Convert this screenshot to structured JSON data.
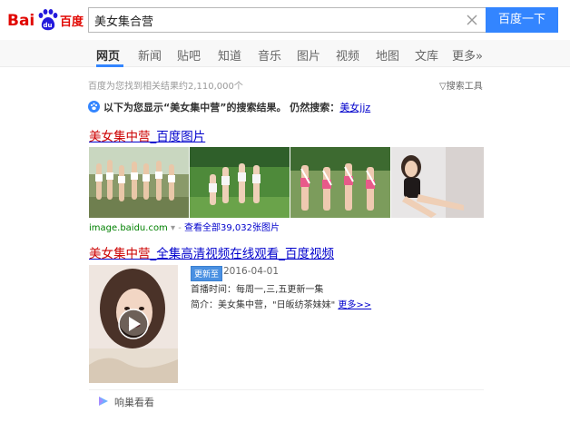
{
  "header": {
    "logo_text_left": "Bai",
    "logo_text_du": "du",
    "logo_text_cn": "百度",
    "search_value": "美女集合营",
    "search_button": "百度一下"
  },
  "tabs": [
    {
      "label": "网页",
      "active": true
    },
    {
      "label": "新闻"
    },
    {
      "label": "贴吧"
    },
    {
      "label": "知道"
    },
    {
      "label": "音乐"
    },
    {
      "label": "图片"
    },
    {
      "label": "视频"
    },
    {
      "label": "地图"
    },
    {
      "label": "文库"
    },
    {
      "label": "更多»"
    }
  ],
  "result_count": "百度为您找到相关结果约2,110,000个",
  "search_tools": "搜索工具",
  "notice": {
    "prefix": "以下为您显示",
    "query": "“美女集中营”",
    "suffix": "的搜索结果。 仍然搜索：",
    "link": "美女jjz"
  },
  "result_image": {
    "title_hl": "美女集中营",
    "title_rest": "_百度图片",
    "source": "image.baidu.com",
    "arrow": "▾",
    "more": "查看全部39,032张图片"
  },
  "result_video": {
    "title_hl": "美女集中营",
    "title_rest": "_全集高清视频在线观看_百度视频",
    "badge": "更新至",
    "date": "2016-04-01",
    "air_label": "首播时间：",
    "air_value": "每周一,三,五更新一集",
    "intro_label": "简介：",
    "intro_value": "美女集中营，\"日皈纺茶妹妹\"",
    "more": "更多>>"
  },
  "footer": {
    "label": "响巢看看"
  },
  "colors": {
    "accent": "#3385ff",
    "link": "#0000cc",
    "highlight": "#cc0000",
    "url_green": "#008000"
  }
}
